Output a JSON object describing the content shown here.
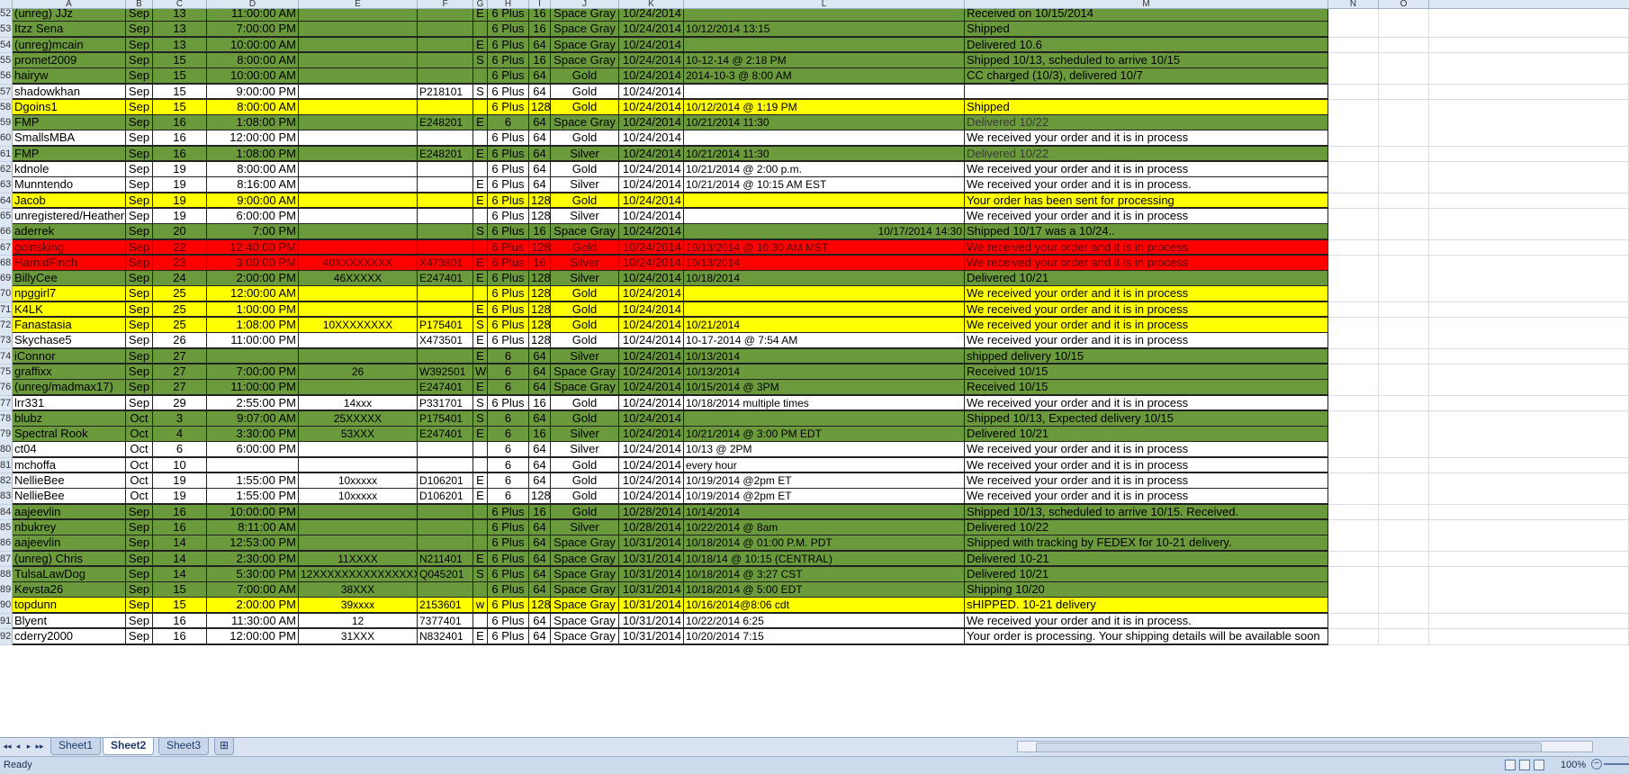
{
  "column_headers": [
    "A",
    "B",
    "C",
    "D",
    "E",
    "F",
    "G",
    "H",
    "I",
    "J",
    "K",
    "L",
    "M",
    "N",
    "O"
  ],
  "rows": [
    {
      "num": "52",
      "bg": "green",
      "a": "(unreg) JJz",
      "b": "Sep",
      "c": "13",
      "d": "11:00:00 AM",
      "e": "",
      "f": "",
      "g": "E",
      "h": "6 Plus",
      "i": "16",
      "j": "Space Gray",
      "k": "10/24/2014",
      "l": "",
      "m": "Received on 10/15/2014"
    },
    {
      "num": "53",
      "bg": "green",
      "a": "Itzz Sena",
      "b": "Sep",
      "c": "13",
      "d": "7:00:00 PM",
      "e": "",
      "f": "",
      "g": "",
      "h": "6 Plus",
      "i": "16",
      "j": "Space Gray",
      "k": "10/24/2014",
      "l": "10/12/2014 13:15",
      "m": "Shipped"
    },
    {
      "num": "54",
      "bg": "green",
      "a": "(unreg)mcain",
      "b": "Sep",
      "c": "13",
      "d": "10:00:00 AM",
      "e": "",
      "f": "",
      "g": "E",
      "h": "6 Plus",
      "i": "64",
      "j": "Space Gray",
      "k": "10/24/2014",
      "l": "",
      "m": "Delivered 10.6"
    },
    {
      "num": "55",
      "bg": "green",
      "a": "promet2009",
      "b": "Sep",
      "c": "15",
      "d": "8:00:00 AM",
      "e": "",
      "f": "",
      "g": "S",
      "h": "6 Plus",
      "i": "16",
      "j": "Space Gray",
      "k": "10/24/2014",
      "l": "10-12-14 @ 2:18 PM",
      "m": "Shipped 10/13, scheduled to arrive 10/15"
    },
    {
      "num": "56",
      "bg": "green",
      "a": "hairyw",
      "b": "Sep",
      "c": "15",
      "d": "10:00:00 AM",
      "e": "",
      "f": "",
      "g": "",
      "h": "6 Plus",
      "i": "64",
      "j": "Gold",
      "k": "10/24/2014",
      "l": "2014-10-3 @ 8:00 AM",
      "m": "CC charged (10/3), delivered 10/7"
    },
    {
      "num": "57",
      "bg": "white",
      "a": "shadowkhan",
      "b": "Sep",
      "c": "15",
      "d": "9:00:00 PM",
      "e": "",
      "f": "P218101",
      "g": "S",
      "h": "6 Plus",
      "i": "64",
      "j": "Gold",
      "k": "10/24/2014",
      "l": "",
      "m": ""
    },
    {
      "num": "58",
      "bg": "yellow",
      "a": "Dgoins1",
      "b": "Sep",
      "c": "15",
      "d": "8:00:00 AM",
      "e": "",
      "f": "",
      "g": "",
      "h": "6 Plus",
      "i": "128",
      "j": "Gold",
      "k": "10/24/2014",
      "l": "10/12/2014 @ 1:19 PM",
      "m": "Shipped"
    },
    {
      "num": "59",
      "bg": "green",
      "a": "FMP",
      "b": "Sep",
      "c": "16",
      "d": "1:08:00 PM",
      "e": "",
      "f": "E248201",
      "g": "E",
      "h": "6",
      "i": "64",
      "j": "Space Gray",
      "k": "10/24/2014",
      "l": "10/21/2014 11:30",
      "m": "Delivered 10/22",
      "mdim": true
    },
    {
      "num": "60",
      "bg": "white",
      "a": "SmallsMBA",
      "b": "Sep",
      "c": "16",
      "d": "12:00:00 PM",
      "e": "",
      "f": "",
      "g": "",
      "h": "6 Plus",
      "i": "64",
      "j": "Gold",
      "k": "10/24/2014",
      "l": "",
      "m": "We received your order and it is in process"
    },
    {
      "num": "61",
      "bg": "green",
      "a": "FMP",
      "b": "Sep",
      "c": "16",
      "d": "1:08:00 PM",
      "e": "",
      "f": "E248201",
      "g": "E",
      "h": "6 Plus",
      "i": "64",
      "j": "Silver",
      "k": "10/24/2014",
      "l": "10/21/2014 11:30",
      "m": "Delivered 10/22",
      "mdim": true
    },
    {
      "num": "62",
      "bg": "white",
      "a": "kdnole",
      "b": "Sep",
      "c": "19",
      "d": "8:00:00 AM",
      "e": "",
      "f": "",
      "g": "",
      "h": "6 Plus",
      "i": "64",
      "j": "Gold",
      "k": "10/24/2014",
      "l": "10/21/2014 @ 2:00 p.m.",
      "m": "We received your order and it is in process"
    },
    {
      "num": "63",
      "bg": "white",
      "a": "Munntendo",
      "b": "Sep",
      "c": "19",
      "d": "8:16:00 AM",
      "e": "",
      "f": "",
      "g": "E",
      "h": "6 Plus",
      "i": "64",
      "j": "Silver",
      "k": "10/24/2014",
      "l": "10/21/2014 @ 10:15 AM EST",
      "m": "We received your order and it is in process."
    },
    {
      "num": "64",
      "bg": "yellow",
      "a": "Jacob",
      "b": "Sep",
      "c": "19",
      "d": "9:00:00 AM",
      "e": "",
      "f": "",
      "g": "E",
      "h": "6 Plus",
      "i": "128",
      "j": "Gold",
      "k": "10/24/2014",
      "l": "",
      "m": "Your order has been sent for processing"
    },
    {
      "num": "65",
      "bg": "white",
      "a": "unregistered/Heather",
      "b": "Sep",
      "c": "19",
      "d": "6:00:00 PM",
      "e": "",
      "f": "",
      "g": "",
      "h": "6 Plus",
      "i": "128",
      "j": "Silver",
      "k": "10/24/2014",
      "l": "",
      "m": "We received your order and it is in process"
    },
    {
      "num": "66",
      "bg": "green",
      "a": "aderrek",
      "b": "Sep",
      "c": "20",
      "d": "7:00 PM",
      "e": "",
      "f": "",
      "g": "S",
      "h": "6 Plus",
      "i": "16",
      "j": "Space Gray",
      "k": "10/24/2014",
      "l": "10/17/2014 14:30",
      "m": "Shipped 10/17 was a 10/24.."
    },
    {
      "num": "67",
      "bg": "red",
      "a": "goinsking",
      "b": "Sep",
      "c": "22",
      "d": "12:40:00 PM",
      "e": "",
      "f": "",
      "g": "",
      "h": "6 Plus",
      "i": "128",
      "j": "Gold",
      "k": "10/24/2014",
      "l": "10/13/2014 @ 10:30 AM MST",
      "m": "We received your order and it is in process"
    },
    {
      "num": "68",
      "bg": "red",
      "a": "HarnidFinch",
      "b": "Sep",
      "c": "23",
      "d": "3:00:00 PM",
      "e": "40XXXXXXXX",
      "f": "X473801",
      "g": "E",
      "h": "6 Plus",
      "i": "16",
      "j": "Silver",
      "k": "10/24/2014",
      "l": "10/13/2014",
      "m": "We received your order and it is in process"
    },
    {
      "num": "69",
      "bg": "green",
      "a": "BillyCee",
      "b": "Sep",
      "c": "24",
      "d": "2:00:00 PM",
      "e": "46XXXXX",
      "f": "E247401",
      "g": "E",
      "h": "6 Plus",
      "i": "128",
      "j": "Silver",
      "k": "10/24/2014",
      "l": "10/18/2014",
      "m": "Delivered 10/21"
    },
    {
      "num": "70",
      "bg": "yellow",
      "a": "npggirl7",
      "b": "Sep",
      "c": "25",
      "d": "12:00:00 AM",
      "e": "",
      "f": "",
      "g": "",
      "h": "6 Plus",
      "i": "128",
      "j": "Gold",
      "k": "10/24/2014",
      "l": "",
      "m": "We received your order and it is in process"
    },
    {
      "num": "71",
      "bg": "yellow",
      "a": "K4LK",
      "b": "Sep",
      "c": "25",
      "d": "1:00:00 PM",
      "e": "",
      "f": "",
      "g": "E",
      "h": "6 Plus",
      "i": "128",
      "j": "Gold",
      "k": "10/24/2014",
      "l": "",
      "m": "We received your order and it is in process"
    },
    {
      "num": "72",
      "bg": "yellow",
      "a": "Fanastasia",
      "b": "Sep",
      "c": "25",
      "d": "1:08:00 PM",
      "e": "10XXXXXXXX",
      "f": "P175401",
      "g": "S",
      "h": "6 Plus",
      "i": "128",
      "j": "Gold",
      "k": "10/24/2014",
      "l": "10/21/2014",
      "m": "We received your order and it is in process"
    },
    {
      "num": "73",
      "bg": "white",
      "a": "Skychase5",
      "b": "Sep",
      "c": "26",
      "d": "11:00:00 PM",
      "e": "",
      "f": "X473501",
      "g": "E",
      "h": "6 Plus",
      "i": "128",
      "j": "Gold",
      "k": "10/24/2014",
      "l": "10-17-2014 @ 7:54 AM",
      "m": "We received your order and it is in process"
    },
    {
      "num": "74",
      "bg": "green",
      "a": "iConnor",
      "b": "Sep",
      "c": "27",
      "d": "",
      "e": "",
      "f": "",
      "g": "E",
      "h": "6",
      "i": "64",
      "j": "Silver",
      "k": "10/24/2014",
      "l": "10/13/2014",
      "m": "shipped delivery 10/15"
    },
    {
      "num": "75",
      "bg": "green",
      "a": "graffixx",
      "b": "Sep",
      "c": "27",
      "d": "7:00:00 PM",
      "e": "26",
      "f": "W392501",
      "g": "W",
      "h": "6",
      "i": "64",
      "j": "Space Gray",
      "k": "10/24/2014",
      "l": "10/13/2014",
      "m": "Received 10/15"
    },
    {
      "num": "76",
      "bg": "green",
      "a": "(unreg/madmax17)",
      "b": "Sep",
      "c": "27",
      "d": "11:00:00 PM",
      "e": "",
      "f": "E247401",
      "g": "E",
      "h": "6",
      "i": "64",
      "j": "Space Gray",
      "k": "10/24/2014",
      "l": "10/15/2014 @ 3PM",
      "m": "Received 10/15"
    },
    {
      "num": "77",
      "bg": "white",
      "a": "lrr331",
      "b": "Sep",
      "c": "29",
      "d": "2:55:00 PM",
      "e": "14xxx",
      "f": "P331701",
      "g": "S",
      "h": "6 Plus",
      "i": "16",
      "j": "Gold",
      "k": "10/24/2014",
      "l": "10/18/2014 multiple times",
      "m": "We received your order and it is in process"
    },
    {
      "num": "78",
      "bg": "green",
      "a": "blubz",
      "b": "Oct",
      "c": "3",
      "d": "9:07:00 AM",
      "e": "25XXXXX",
      "f": "P175401",
      "g": "S",
      "h": "6",
      "i": "64",
      "j": "Gold",
      "k": "10/24/2014",
      "l": "",
      "m": "Shipped 10/13, Expected delivery 10/15"
    },
    {
      "num": "79",
      "bg": "green",
      "a": "Spectral Rook",
      "b": "Oct",
      "c": "4",
      "d": "3:30:00 PM",
      "e": "53XXX",
      "f": "E247401",
      "g": "E",
      "h": "6",
      "i": "16",
      "j": "Silver",
      "k": "10/24/2014",
      "l": "10/21/2014 @ 3:00 PM EDT",
      "m": "Delivered 10/21"
    },
    {
      "num": "80",
      "bg": "white",
      "a": "ct04",
      "b": "Oct",
      "c": "6",
      "d": "6:00:00 PM",
      "e": "",
      "f": "",
      "g": "",
      "h": "6",
      "i": "64",
      "j": "Silver",
      "k": "10/24/2014",
      "l": "10/13 @ 2PM",
      "m": "We received your order and it is in process"
    },
    {
      "num": "81",
      "bg": "white",
      "a": "mchoffa",
      "b": "Oct",
      "c": "10",
      "d": "",
      "e": "",
      "f": "",
      "g": "",
      "h": "6",
      "i": "64",
      "j": "Gold",
      "k": "10/24/2014",
      "l": "every hour",
      "m": "We received your order and it is in process"
    },
    {
      "num": "82",
      "bg": "white",
      "a": "NellieBee",
      "b": "Oct",
      "c": "19",
      "d": "1:55:00 PM",
      "e": "10xxxxx",
      "f": "D106201",
      "g": "E",
      "h": "6",
      "i": "64",
      "j": "Gold",
      "k": "10/24/2014",
      "l": "10/19/2014 @2pm ET",
      "m": "We received your order and it is in process"
    },
    {
      "num": "83",
      "bg": "white",
      "a": "NellieBee",
      "b": "Oct",
      "c": "19",
      "d": "1:55:00 PM",
      "e": "10xxxxx",
      "f": "D106201",
      "g": "E",
      "h": "6",
      "i": "128",
      "j": "Gold",
      "k": "10/24/2014",
      "l": "10/19/2014 @2pm ET",
      "m": "We received your order and it is in process"
    },
    {
      "num": "84",
      "bg": "green",
      "a": "aajeevlin",
      "b": "Sep",
      "c": "16",
      "d": "10:00:00 PM",
      "e": "",
      "f": "",
      "g": "",
      "h": "6 Plus",
      "i": "16",
      "j": "Gold",
      "k": "10/28/2014",
      "l": "10/14/2014",
      "m": "Shipped 10/13, scheduled to arrive 10/15. Received."
    },
    {
      "num": "85",
      "bg": "green",
      "a": "nbukrey",
      "b": "Sep",
      "c": "16",
      "d": "8:11:00 AM",
      "e": "",
      "f": "",
      "g": "",
      "h": "6 Plus",
      "i": "64",
      "j": "Silver",
      "k": "10/28/2014",
      "l": "10/22/2014 @ 8am",
      "m": "Delivered 10/22"
    },
    {
      "num": "86",
      "bg": "green",
      "a": "aajeevlin",
      "b": "Sep",
      "c": "14",
      "d": "12:53:00 PM",
      "e": "",
      "f": "",
      "g": "",
      "h": "6 Plus",
      "i": "64",
      "j": "Space Gray",
      "k": "10/31/2014",
      "l": "10/18/2014 @ 01:00 P.M. PDT",
      "m": "Shipped with tracking by FEDEX for 10-21 delivery."
    },
    {
      "num": "87",
      "bg": "green",
      "a": "(unreg) Chris",
      "b": "Sep",
      "c": "14",
      "d": "2:30:00 PM",
      "e": "11XXXX",
      "f": "N211401",
      "g": "E",
      "h": "6 Plus",
      "i": "64",
      "j": "Space Gray",
      "k": "10/31/2014",
      "l": "10/18/14 @ 10:15 (CENTRAL)",
      "m": "Delivered 10-21"
    },
    {
      "num": "88",
      "bg": "green",
      "a": "TulsaLawDog",
      "b": "Sep",
      "c": "14",
      "d": "5:30:00 PM",
      "e": "12XXXXXXXXXXXXXXX",
      "f": "Q045201",
      "g": "S",
      "h": "6 Plus",
      "i": "64",
      "j": "Space Gray",
      "k": "10/31/2014",
      "l": "10/18/2014 @ 3:27 CST",
      "m": "Delivered 10/21"
    },
    {
      "num": "89",
      "bg": "green",
      "a": "Kevsta26",
      "b": "Sep",
      "c": "15",
      "d": "7:00:00 AM",
      "e": "38XXX",
      "f": "",
      "g": "",
      "h": "6 Plus",
      "i": "64",
      "j": "Space Gray",
      "k": "10/31/2014",
      "l": "10/18/2014 @ 5:00 EDT",
      "m": "Shipping 10/20"
    },
    {
      "num": "90",
      "bg": "yellow",
      "a": "topdunn",
      "b": "Sep",
      "c": "15",
      "d": "2:00:00 PM",
      "e": "39xxxx",
      "f": "2153601",
      "g": "w",
      "h": "6 Plus",
      "i": "128",
      "j": "Space Gray",
      "k": "10/31/2014",
      "l": "10/16/2014@8:06 cdt",
      "m": "sHIPPED. 10-21 delivery"
    },
    {
      "num": "91",
      "bg": "white",
      "a": "Blyent",
      "b": "Sep",
      "c": "16",
      "d": "11:30:00 AM",
      "e": "12",
      "f": "7377401",
      "g": "",
      "h": "6 Plus",
      "i": "64",
      "j": "Space Gray",
      "k": "10/31/2014",
      "l": "10/22/2014 6:25",
      "m": "We received your order and it is in process."
    },
    {
      "num": "92",
      "bg": "white",
      "a": "cderry2000",
      "b": "Sep",
      "c": "16",
      "d": "12:00:00 PM",
      "e": "31XXX",
      "f": "N832401",
      "g": "E",
      "h": "6 Plus",
      "i": "64",
      "j": "Space Gray",
      "k": "10/31/2014",
      "l": "10/20/2014 7:15",
      "m": "Your order is processing. Your shipping details will be available soon"
    }
  ],
  "sheet_tabs": [
    "Sheet1",
    "Sheet2",
    "Sheet3"
  ],
  "active_tab": "Sheet2",
  "nav_glyphs": {
    "first": "◂◂",
    "prev": "◂",
    "next": "▸",
    "last": "▸▸",
    "new_sheet": "⊞"
  },
  "status": {
    "ready": "Ready",
    "zoom": "100%",
    "zoom_minus": "−"
  },
  "colors": {
    "green": "#6a9a3c",
    "yellow": "#ffff00",
    "red": "#ff0000",
    "white": "#ffffff"
  }
}
